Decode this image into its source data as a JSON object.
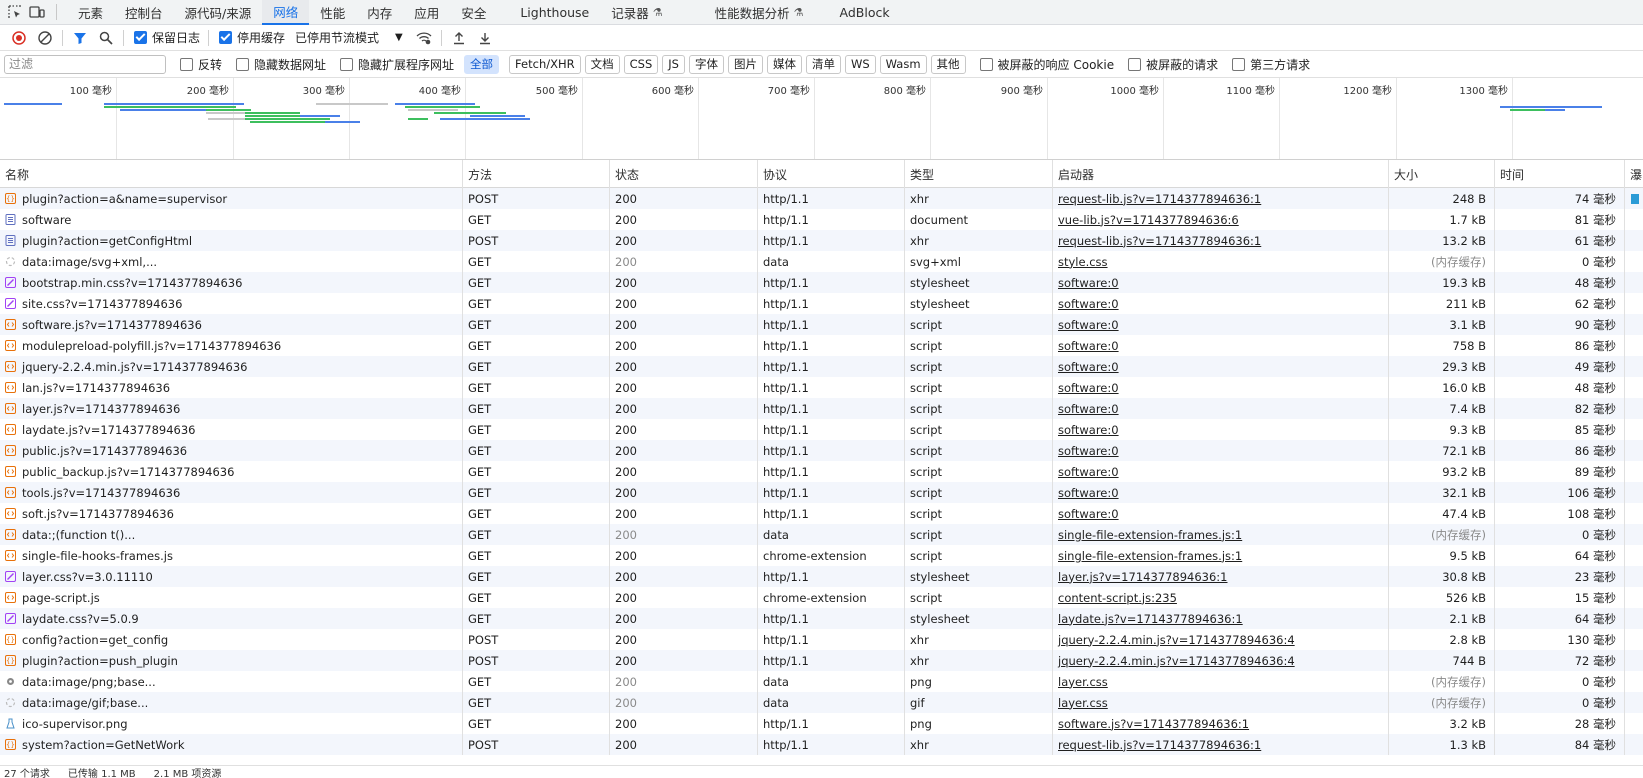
{
  "tabs": [
    {
      "label": "元素"
    },
    {
      "label": "控制台"
    },
    {
      "label": "源代码/来源"
    },
    {
      "label": "网络",
      "active": true
    },
    {
      "label": "性能"
    },
    {
      "label": "内存"
    },
    {
      "label": "应用"
    },
    {
      "label": "安全"
    },
    {
      "label": "Lighthouse"
    },
    {
      "label": "记录器",
      "icon": "flask-icon"
    },
    {
      "label": "性能数据分析",
      "icon": "flask-icon"
    },
    {
      "label": "AdBlock"
    }
  ],
  "toolbar": {
    "preserve_log": "保留日志",
    "disable_cache": "停用缓存",
    "throttling": "已停用节流模式"
  },
  "filter": {
    "placeholder": "过滤",
    "invert": "反转",
    "hide_data_urls": "隐藏数据网址",
    "hide_extension_urls": "隐藏扩展程序网址",
    "types": [
      "全部",
      "Fetch/XHR",
      "文档",
      "CSS",
      "JS",
      "字体",
      "图片",
      "媒体",
      "清单",
      "WS",
      "Wasm",
      "其他"
    ],
    "blocked_cookies": "被屏蔽的响应 Cookie",
    "blocked_requests": "被屏蔽的请求",
    "third_party": "第三方请求"
  },
  "overview": {
    "ticks": [
      "100 毫秒",
      "200 毫秒",
      "300 毫秒",
      "400 毫秒",
      "500 毫秒",
      "600 毫秒",
      "700 毫秒",
      "800 毫秒",
      "900 毫秒",
      "1000 毫秒",
      "1100 毫秒",
      "1200 毫秒",
      "1300 毫秒"
    ]
  },
  "columns": {
    "name": "名称",
    "method": "方法",
    "status": "状态",
    "protocol": "协议",
    "type": "类型",
    "initiator": "启动器",
    "size": "大小",
    "time": "时间",
    "waterfall": "瀑"
  },
  "rows": [
    {
      "name": "plugin?action=a&name=supervisor",
      "method": "POST",
      "status": "200",
      "protocol": "http/1.1",
      "type": "xhr",
      "initiator": "request-lib.js?v=1714377894636:1",
      "size": "248 B",
      "time": "74 毫秒",
      "icon": "xhr-icon"
    },
    {
      "name": "software",
      "method": "GET",
      "status": "200",
      "protocol": "http/1.1",
      "type": "document",
      "initiator": "vue-lib.js?v=1714377894636:6",
      "size": "1.7 kB",
      "time": "81 毫秒",
      "icon": "document-icon"
    },
    {
      "name": "plugin?action=getConfigHtml",
      "method": "POST",
      "status": "200",
      "protocol": "http/1.1",
      "type": "xhr",
      "initiator": "request-lib.js?v=1714377894636:1",
      "size": "13.2 kB",
      "time": "61 毫秒",
      "icon": "document-icon"
    },
    {
      "name": "data:image/svg+xml,...",
      "method": "GET",
      "status": "200",
      "protocol": "data",
      "type": "svg+xml",
      "initiator": "style.css",
      "size": "(内存缓存)",
      "time": "0 毫秒",
      "icon": "spinner-icon",
      "dim": true
    },
    {
      "name": "bootstrap.min.css?v=1714377894636",
      "method": "GET",
      "status": "200",
      "protocol": "http/1.1",
      "type": "stylesheet",
      "initiator": "software:0",
      "size": "19.3 kB",
      "time": "48 毫秒",
      "icon": "stylesheet-icon"
    },
    {
      "name": "site.css?v=1714377894636",
      "method": "GET",
      "status": "200",
      "protocol": "http/1.1",
      "type": "stylesheet",
      "initiator": "software:0",
      "size": "211 kB",
      "time": "62 毫秒",
      "icon": "stylesheet-icon"
    },
    {
      "name": "software.js?v=1714377894636",
      "method": "GET",
      "status": "200",
      "protocol": "http/1.1",
      "type": "script",
      "initiator": "software:0",
      "size": "3.1 kB",
      "time": "90 毫秒",
      "icon": "script-icon"
    },
    {
      "name": "modulepreload-polyfill.js?v=1714377894636",
      "method": "GET",
      "status": "200",
      "protocol": "http/1.1",
      "type": "script",
      "initiator": "software:0",
      "size": "758 B",
      "time": "86 毫秒",
      "icon": "script-icon"
    },
    {
      "name": "jquery-2.2.4.min.js?v=1714377894636",
      "method": "GET",
      "status": "200",
      "protocol": "http/1.1",
      "type": "script",
      "initiator": "software:0",
      "size": "29.3 kB",
      "time": "49 毫秒",
      "icon": "script-icon"
    },
    {
      "name": "lan.js?v=1714377894636",
      "method": "GET",
      "status": "200",
      "protocol": "http/1.1",
      "type": "script",
      "initiator": "software:0",
      "size": "16.0 kB",
      "time": "48 毫秒",
      "icon": "script-icon"
    },
    {
      "name": "layer.js?v=1714377894636",
      "method": "GET",
      "status": "200",
      "protocol": "http/1.1",
      "type": "script",
      "initiator": "software:0",
      "size": "7.4 kB",
      "time": "82 毫秒",
      "icon": "script-icon"
    },
    {
      "name": "laydate.js?v=1714377894636",
      "method": "GET",
      "status": "200",
      "protocol": "http/1.1",
      "type": "script",
      "initiator": "software:0",
      "size": "9.3 kB",
      "time": "85 毫秒",
      "icon": "script-icon"
    },
    {
      "name": "public.js?v=1714377894636",
      "method": "GET",
      "status": "200",
      "protocol": "http/1.1",
      "type": "script",
      "initiator": "software:0",
      "size": "72.1 kB",
      "time": "86 毫秒",
      "icon": "script-icon"
    },
    {
      "name": "public_backup.js?v=1714377894636",
      "method": "GET",
      "status": "200",
      "protocol": "http/1.1",
      "type": "script",
      "initiator": "software:0",
      "size": "93.2 kB",
      "time": "89 毫秒",
      "icon": "script-icon"
    },
    {
      "name": "tools.js?v=1714377894636",
      "method": "GET",
      "status": "200",
      "protocol": "http/1.1",
      "type": "script",
      "initiator": "software:0",
      "size": "32.1 kB",
      "time": "106 毫秒",
      "icon": "script-icon"
    },
    {
      "name": "soft.js?v=1714377894636",
      "method": "GET",
      "status": "200",
      "protocol": "http/1.1",
      "type": "script",
      "initiator": "software:0",
      "size": "47.4 kB",
      "time": "108 毫秒",
      "icon": "script-icon"
    },
    {
      "name": "data:;(function t()...",
      "method": "GET",
      "status": "200",
      "protocol": "data",
      "type": "script",
      "initiator": "single-file-extension-frames.js:1",
      "size": "(内存缓存)",
      "time": "0 毫秒",
      "icon": "script-icon",
      "dim": true
    },
    {
      "name": "single-file-hooks-frames.js",
      "method": "GET",
      "status": "200",
      "protocol": "chrome-extension",
      "type": "script",
      "initiator": "single-file-extension-frames.js:1",
      "size": "9.5 kB",
      "time": "64 毫秒",
      "icon": "script-icon"
    },
    {
      "name": "layer.css?v=3.0.11110",
      "method": "GET",
      "status": "200",
      "protocol": "http/1.1",
      "type": "stylesheet",
      "initiator": "layer.js?v=1714377894636:1",
      "size": "30.8 kB",
      "time": "23 毫秒",
      "icon": "stylesheet-icon"
    },
    {
      "name": "page-script.js",
      "method": "GET",
      "status": "200",
      "protocol": "chrome-extension",
      "type": "script",
      "initiator": "content-script.js:235",
      "size": "526 kB",
      "time": "15 毫秒",
      "icon": "script-icon"
    },
    {
      "name": "laydate.css?v=5.0.9",
      "method": "GET",
      "status": "200",
      "protocol": "http/1.1",
      "type": "stylesheet",
      "initiator": "laydate.js?v=1714377894636:1",
      "size": "2.1 kB",
      "time": "64 毫秒",
      "icon": "stylesheet-icon"
    },
    {
      "name": "config?action=get_config",
      "method": "POST",
      "status": "200",
      "protocol": "http/1.1",
      "type": "xhr",
      "initiator": "jquery-2.2.4.min.js?v=1714377894636:4",
      "size": "2.8 kB",
      "time": "130 毫秒",
      "icon": "xhr-icon"
    },
    {
      "name": "plugin?action=push_plugin",
      "method": "POST",
      "status": "200",
      "protocol": "http/1.1",
      "type": "xhr",
      "initiator": "jquery-2.2.4.min.js?v=1714377894636:4",
      "size": "744 B",
      "time": "72 毫秒",
      "icon": "xhr-icon"
    },
    {
      "name": "data:image/png;base...",
      "method": "GET",
      "status": "200",
      "protocol": "data",
      "type": "png",
      "initiator": "layer.css",
      "size": "(内存缓存)",
      "time": "0 毫秒",
      "icon": "gear-small-icon",
      "dim": true
    },
    {
      "name": "data:image/gif;base...",
      "method": "GET",
      "status": "200",
      "protocol": "data",
      "type": "gif",
      "initiator": "layer.css",
      "size": "(内存缓存)",
      "time": "0 毫秒",
      "icon": "spinner-icon",
      "dim": true
    },
    {
      "name": "ico-supervisor.png",
      "method": "GET",
      "status": "200",
      "protocol": "http/1.1",
      "type": "png",
      "initiator": "software.js?v=1714377894636:1",
      "size": "3.2 kB",
      "time": "28 毫秒",
      "icon": "image-icon"
    },
    {
      "name": "system?action=GetNetWork",
      "method": "POST",
      "status": "200",
      "protocol": "http/1.1",
      "type": "xhr",
      "initiator": "request-lib.js?v=1714377894636:1",
      "size": "1.3 kB",
      "time": "84 毫秒",
      "icon": "xhr-icon"
    }
  ],
  "status_bar": {
    "requests": "27 个请求",
    "transferred": "已传输 1.1 MB",
    "resources": "2.1 MB 项资源"
  },
  "colors": {
    "accent": "#1a73e8",
    "xhr": "#e8710a",
    "script": "#e8710a",
    "stylesheet": "#a142f4",
    "document": "#5f6fbf"
  }
}
